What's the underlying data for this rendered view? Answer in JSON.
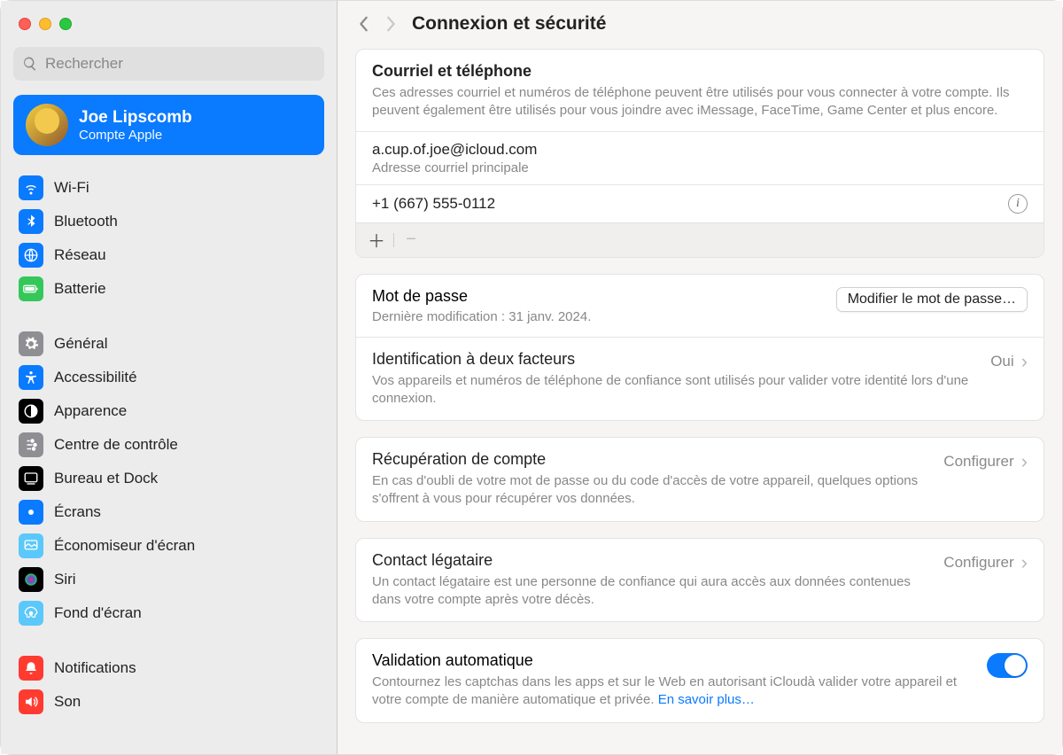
{
  "search_placeholder": "Rechercher",
  "account": {
    "name": "Joe Lipscomb",
    "subtitle": "Compte Apple"
  },
  "nav": {
    "group1": [
      {
        "id": "wifi",
        "label": "Wi-Fi",
        "color": "#0a7aff"
      },
      {
        "id": "bluetooth",
        "label": "Bluetooth",
        "color": "#0a7aff"
      },
      {
        "id": "network",
        "label": "Réseau",
        "color": "#0a7aff"
      },
      {
        "id": "battery",
        "label": "Batterie",
        "color": "#34c759"
      }
    ],
    "group2": [
      {
        "id": "general",
        "label": "Général",
        "color": "#8e8e93"
      },
      {
        "id": "accessibility",
        "label": "Accessibilité",
        "color": "#0a7aff"
      },
      {
        "id": "appearance",
        "label": "Apparence",
        "color": "#000"
      },
      {
        "id": "controlcenter",
        "label": "Centre de contrôle",
        "color": "#8e8e93"
      },
      {
        "id": "desktop",
        "label": "Bureau et Dock",
        "color": "#000"
      },
      {
        "id": "displays",
        "label": "Écrans",
        "color": "#0a7aff"
      },
      {
        "id": "screensaver",
        "label": "Économiseur d'écran",
        "color": "#5ac8fa"
      },
      {
        "id": "siri",
        "label": "Siri",
        "color": "#000"
      },
      {
        "id": "wallpaper",
        "label": "Fond d'écran",
        "color": "#5ac8fa"
      }
    ],
    "group3": [
      {
        "id": "notifications",
        "label": "Notifications",
        "color": "#ff3b30"
      },
      {
        "id": "sound",
        "label": "Son",
        "color": "#ff3b30"
      }
    ]
  },
  "page_title": "Connexion et sécurité",
  "email_section": {
    "title": "Courriel et téléphone",
    "description": "Ces adresses courriel et numéros de téléphone peuvent être utilisés pour vous connecter à votre compte. Ils peuvent également être utilisés pour vous joindre avec iMessage, FaceTime, Game Center et plus encore.",
    "email": "a.cup.of.joe@icloud.com",
    "email_sub": "Adresse courriel principale",
    "phone": "+1 (667) 555-0112"
  },
  "password_section": {
    "title": "Mot de passe",
    "modified": "Dernière modification : 31 janv. 2024.",
    "button": "Modifier le mot de passe…"
  },
  "twofa": {
    "title": "Identification à deux facteurs",
    "description": "Vos appareils et numéros de téléphone de confiance sont utilisés pour valider votre identité lors d'une connexion.",
    "status": "Oui"
  },
  "recovery": {
    "title": "Récupération de compte",
    "description": "En cas d'oubli de votre mot de passe ou du code d'accès de votre appareil, quelques options s'offrent à vous pour récupérer vos données.",
    "action": "Configurer"
  },
  "legacy": {
    "title": "Contact légataire",
    "description": "Un contact légataire est une personne de confiance qui aura accès aux données contenues dans votre compte après votre décès.",
    "action": "Configurer"
  },
  "auto": {
    "title": "Validation automatique",
    "description": "Contournez les captchas dans les apps et sur le Web en autorisant iCloudà valider votre appareil et votre compte de manière automatique et privée. ",
    "link": "En savoir plus…",
    "enabled": true
  }
}
